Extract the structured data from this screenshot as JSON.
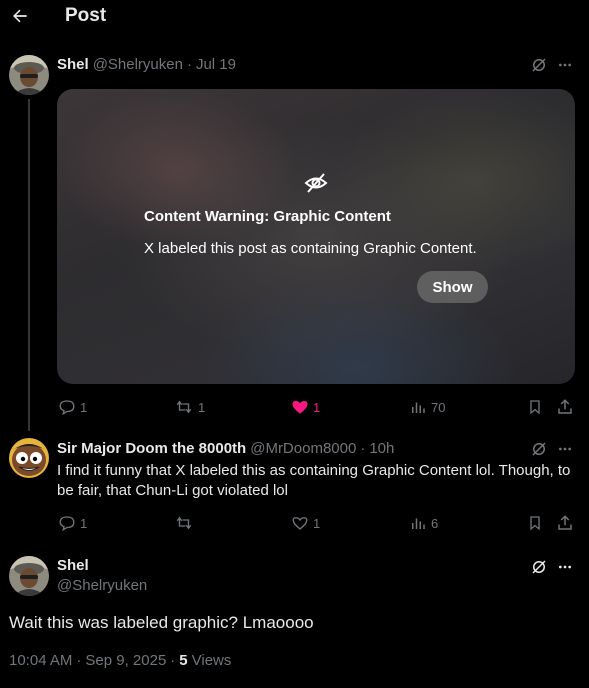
{
  "header": {
    "title": "Post",
    "back_icon": "arrow-left-icon"
  },
  "post1": {
    "name": "Shel",
    "handle": "@Shelryuken",
    "sep": "·",
    "date": "Jul 19",
    "content_warning": {
      "title": "Content Warning: Graphic Content",
      "text": "X labeled this post as containing Graphic Content.",
      "show_label": "Show",
      "icon": "eye-slash-icon"
    },
    "actions": {
      "replies": "1",
      "reposts": "1",
      "likes": "1",
      "views": "70"
    }
  },
  "post2": {
    "name": "Sir Major Doom the 8000th",
    "handle": "@MrDoom8000",
    "sep": "·",
    "time": "10h",
    "text": "I find it funny that X labeled this as containing Graphic Content lol. Though, to be fair, that Chun-Li got violated lol",
    "actions": {
      "replies": "1",
      "reposts": "",
      "likes": "1",
      "views": "6"
    }
  },
  "main_post": {
    "name": "Shel",
    "handle": "@Shelryuken",
    "text": "Wait this was labeled graphic? Lmaoooo",
    "time": "10:04 AM",
    "sep1": "·",
    "date": "Sep 9, 2025",
    "sep2": "·",
    "views_count": "5",
    "views_label": "Views"
  },
  "colors": {
    "like_active": "#f91880",
    "muted": "#71767b",
    "text": "#e7e9ea",
    "background": "#000000"
  }
}
